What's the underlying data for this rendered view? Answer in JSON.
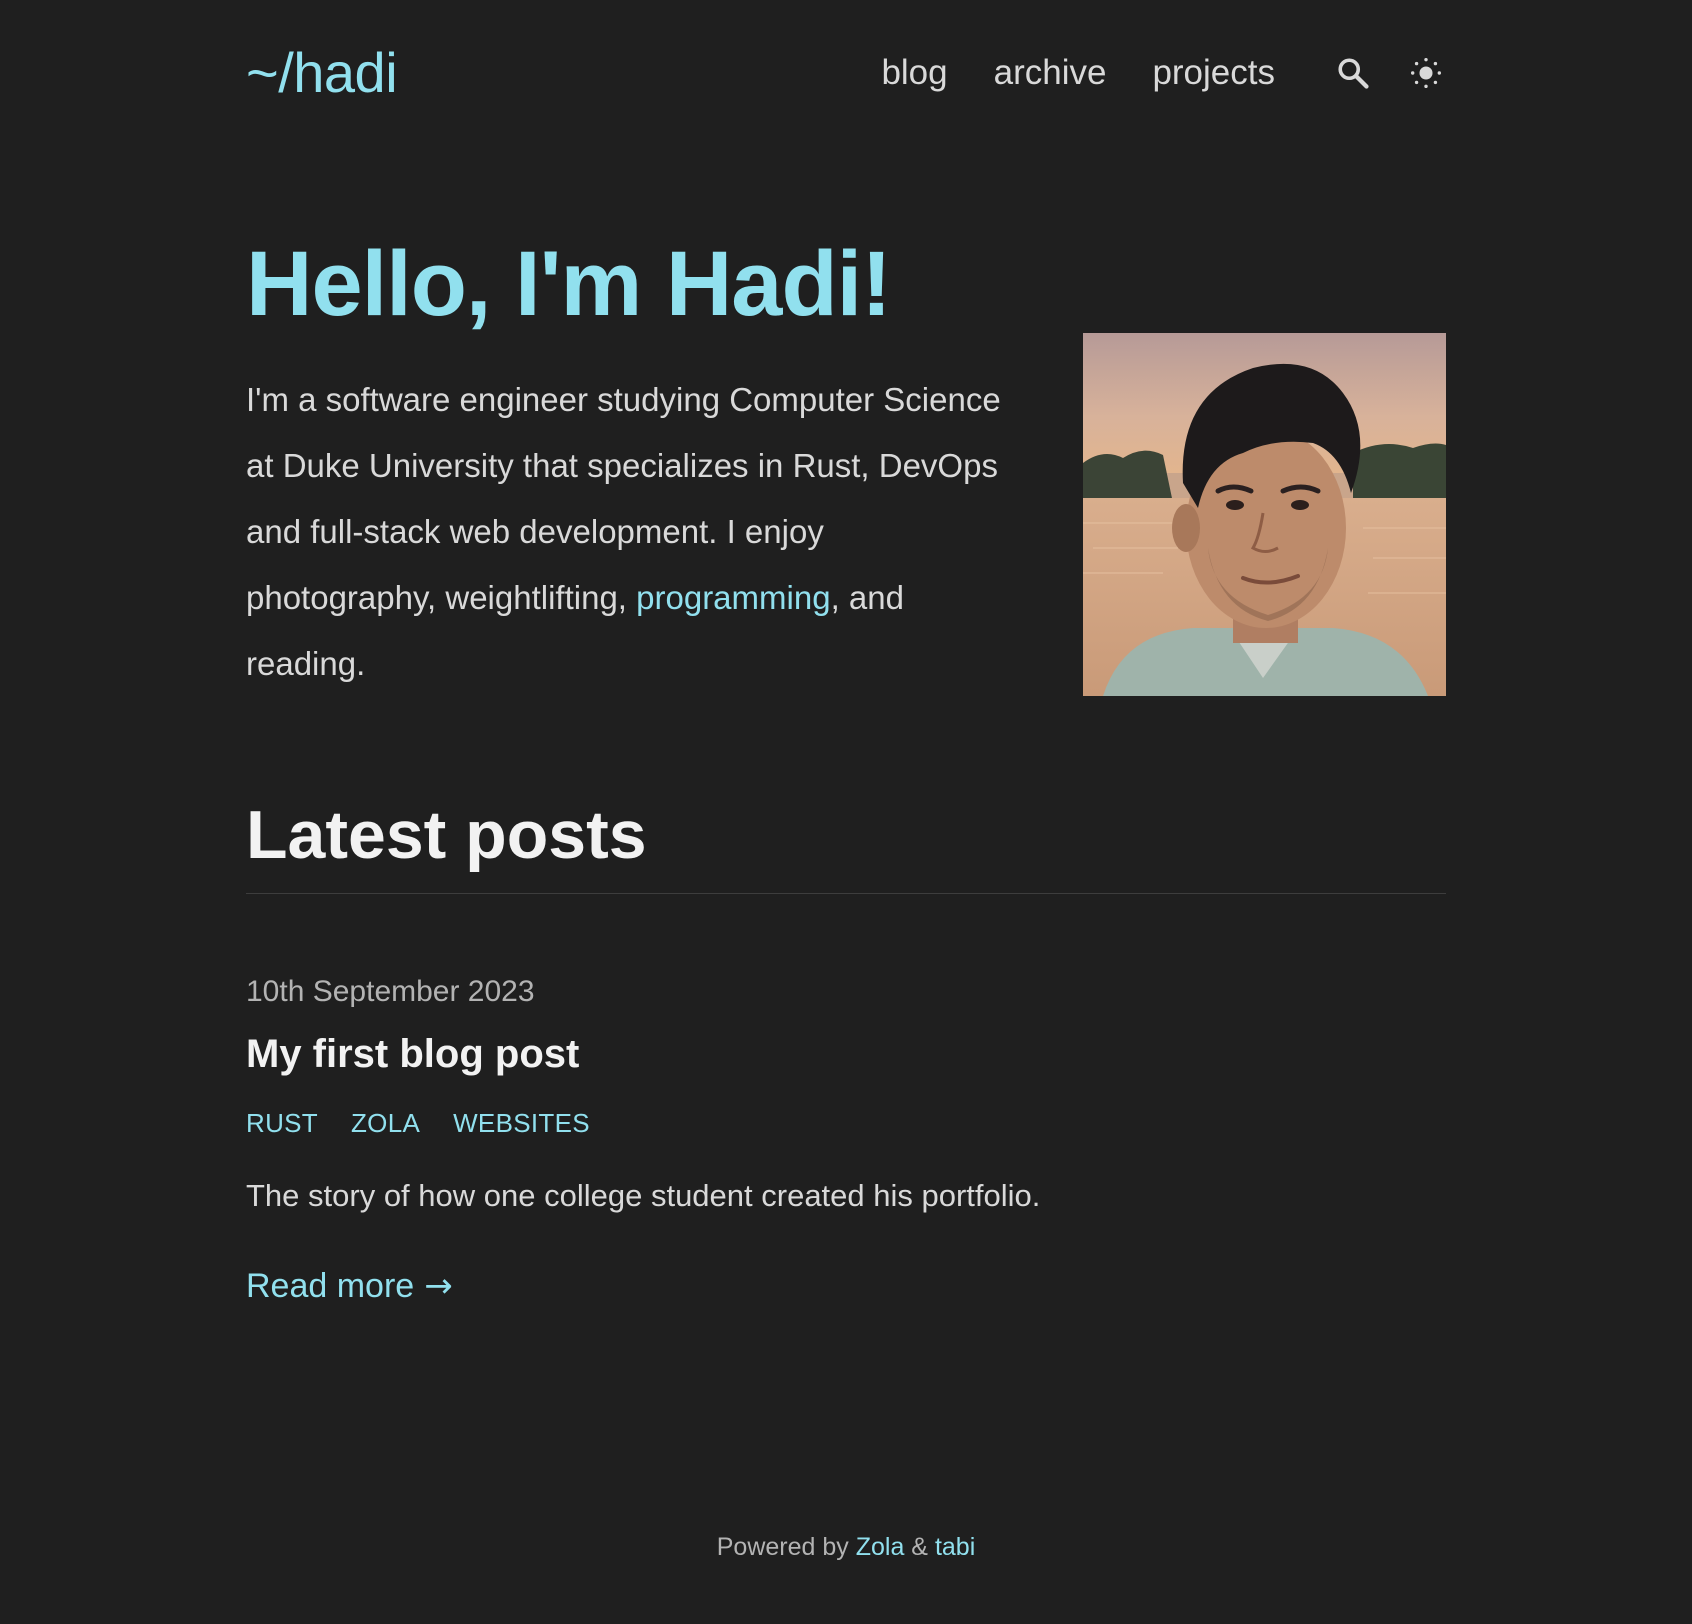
{
  "header": {
    "site_title": "~/hadi",
    "nav": [
      {
        "label": "blog"
      },
      {
        "label": "archive"
      },
      {
        "label": "projects"
      }
    ],
    "search_icon": "search-icon",
    "theme_icon": "sun-icon"
  },
  "hero": {
    "title": "Hello, I'm Hadi!",
    "bio_before": "I'm a software engineer studying Computer Science at Duke University that specializes in Rust, DevOps and full-stack web development. I enjoy photography, weightlifting, ",
    "bio_link": "programming",
    "bio_after": ", and reading."
  },
  "latest": {
    "title": "Latest posts",
    "posts": [
      {
        "date": "10th September 2023",
        "title": "My first blog post",
        "tags": [
          "RUST",
          "ZOLA",
          "WEBSITES"
        ],
        "summary": "The story of how one college student created his portfolio.",
        "read_more": "Read more",
        "read_more_arrow": "→"
      }
    ]
  },
  "footer": {
    "prefix": "Powered by ",
    "link1": "Zola",
    "separator": " & ",
    "link2": "tabi"
  },
  "colors": {
    "background": "#1f1f1f",
    "accent": "#91e0ee",
    "text": "#d9d9d9",
    "heading": "#f2f2f2",
    "muted": "#b3b3b3"
  }
}
